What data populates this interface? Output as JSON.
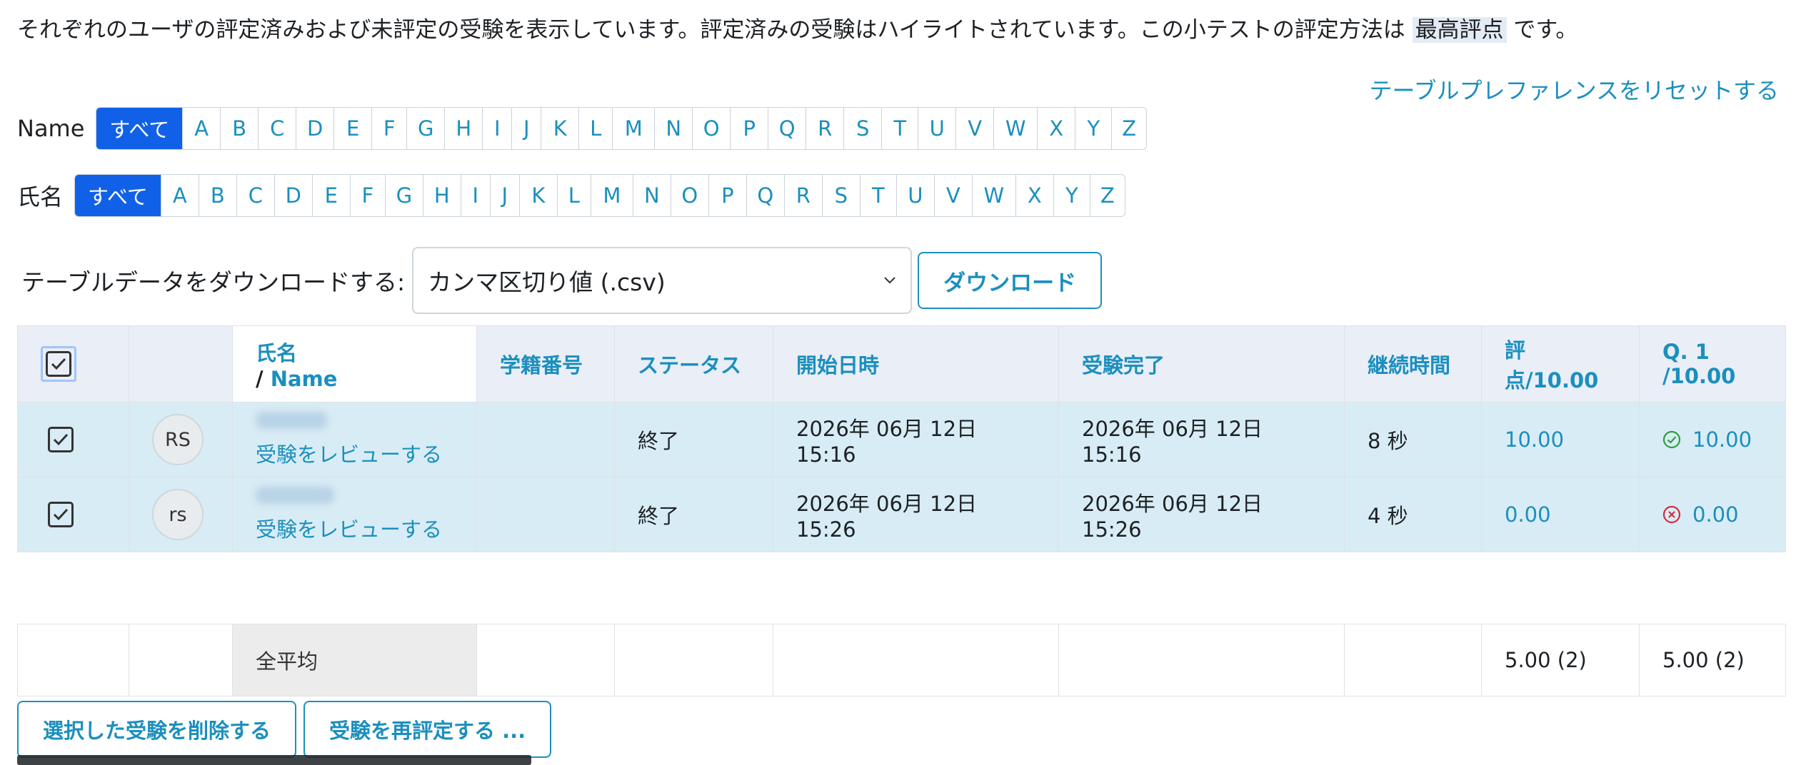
{
  "intro": {
    "text": "それぞれのユーザの評定済みおよび未評定の受験を表示しています。評定済みの受験はハイライトされています。この小テストの評定方法は",
    "method": "最高評点",
    "suffix": "です。"
  },
  "reset_link": "テーブルプレファレンスをリセットする",
  "filters": {
    "firstname_label": "Name",
    "lastname_label": "氏名",
    "all_label": "すべて",
    "letters": [
      "A",
      "B",
      "C",
      "D",
      "E",
      "F",
      "G",
      "H",
      "I",
      "J",
      "K",
      "L",
      "M",
      "N",
      "O",
      "P",
      "Q",
      "R",
      "S",
      "T",
      "U",
      "V",
      "W",
      "X",
      "Y",
      "Z"
    ]
  },
  "download": {
    "label": "テーブルデータをダウンロードする:",
    "format": "カンマ区切り値 (.csv)",
    "button": "ダウンロード"
  },
  "table": {
    "headers": {
      "name_line1": "氏名",
      "name_line2_prefix": "/ ",
      "name_line2": "Name",
      "idnumber": "学籍番号",
      "status": "ステータス",
      "started": "開始日時",
      "finished": "受験完了",
      "duration": "継続時間",
      "grade": "評点/10.00",
      "q1_line1": "Q. 1",
      "q1_line2": "/10.00"
    },
    "rows": [
      {
        "initials": "RS",
        "review": "受験をレビューする",
        "status": "終了",
        "started": "2026年 06月 12日 15:16",
        "finished": "2026年 06月 12日 15:16",
        "duration": "8 秒",
        "grade": "10.00",
        "q1": "10.00",
        "q1_state": "correct"
      },
      {
        "initials": "rs",
        "review": "受験をレビューする",
        "status": "終了",
        "started": "2026年 06月 12日 15:26",
        "finished": "2026年 06月 12日 15:26",
        "duration": "4 秒",
        "grade": "0.00",
        "q1": "0.00",
        "q1_state": "incorrect"
      }
    ],
    "average": {
      "label": "全平均",
      "grade": "5.00 (2)",
      "q1": "5.00 (2)"
    }
  },
  "actions": {
    "delete": "選択した受験を削除する",
    "regrade": "受験を再評定する ..."
  },
  "colors": {
    "accent": "#1b8fbf",
    "active_filter": "#1161e8",
    "row_highlight": "#d8ecf5",
    "correct": "#2e9e3f",
    "incorrect": "#d22d3d"
  }
}
